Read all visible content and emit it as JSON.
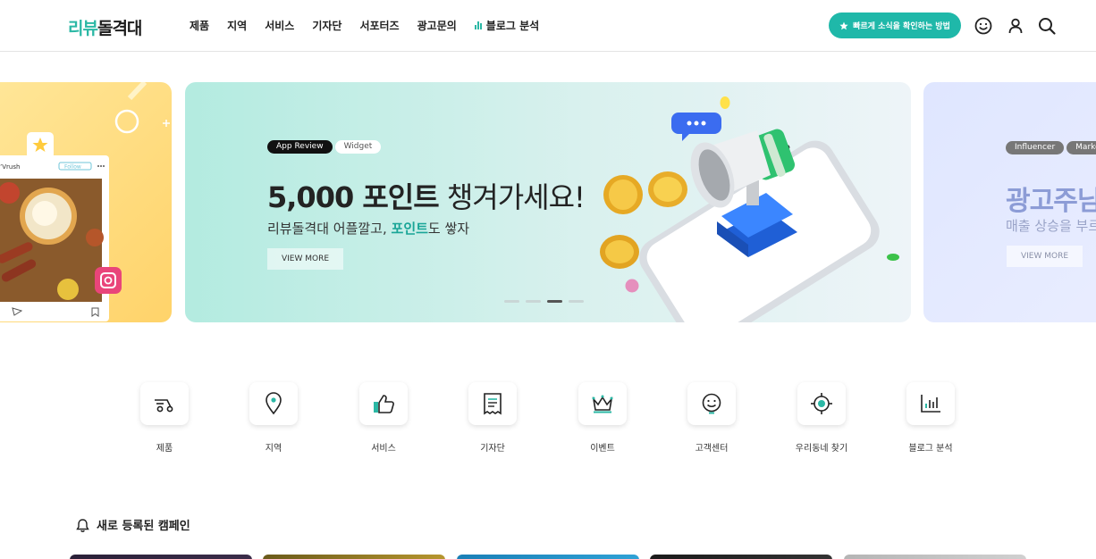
{
  "header": {
    "logo_part1": "리뷰",
    "logo_part2": "돌격대",
    "nav": [
      "제품",
      "지역",
      "서비스",
      "기자단",
      "서포터즈",
      "광고문의",
      "블로그 분석"
    ],
    "cta_label": "빠르게 소식을 확인하는 방법",
    "icons": [
      "smile-icon",
      "user-icon",
      "search-icon"
    ]
  },
  "banners": {
    "main": {
      "tags": [
        "App Review",
        "Widget"
      ],
      "headline_bold": "5,000 포인트",
      "headline_thin": " 챙겨가세요!",
      "sub_before": "리뷰돌격대 어플깔고, ",
      "sub_highlight": "포인트",
      "sub_after": "도 쌓자",
      "button": "VIEW MORE",
      "slide_count": 4,
      "active_slide": 3
    },
    "right": {
      "tags": [
        "Influencer",
        "Marke"
      ],
      "headline": "광고주님",
      "sub": "매출 상승을 부르는",
      "button": "VIEW MORE"
    },
    "left": {
      "card_user": "’Vrush",
      "card_follow": "Follow"
    }
  },
  "categories": [
    {
      "label": "제품",
      "icon": "scooter-icon"
    },
    {
      "label": "지역",
      "icon": "map-pin-icon"
    },
    {
      "label": "서비스",
      "icon": "thumbs-up-icon"
    },
    {
      "label": "기자단",
      "icon": "document-icon"
    },
    {
      "label": "이벤트",
      "icon": "crown-icon"
    },
    {
      "label": "고객센터",
      "icon": "support-smile-icon"
    },
    {
      "label": "우리동네 찾기",
      "icon": "target-icon"
    },
    {
      "label": "블로그 분석",
      "icon": "bar-chart-icon"
    }
  ],
  "section": {
    "title": "새로 등록된 캠페인",
    "icon": "bell-icon"
  },
  "colors": {
    "brand": "#2bb8a5",
    "cta": "#1fb8a9"
  }
}
